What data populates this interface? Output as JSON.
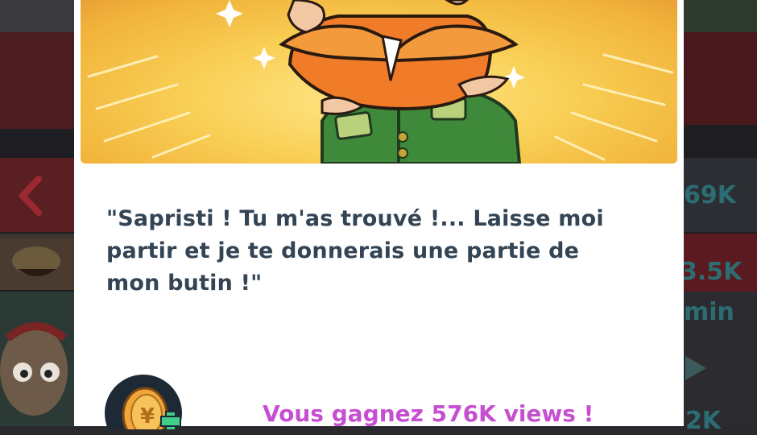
{
  "dialog": {
    "quote": "\"Sapristi ! Tu m'as trouvé !... Laisse moi partir et je te donnerais une partie de mon butin !\"",
    "reward": "Vous gagnez 576K views !",
    "reward_icon": "coin-plus-icon",
    "character_icon": "leprechaun-character"
  },
  "background": {
    "stats": [
      "69K",
      "3.5K",
      "min",
      "2K"
    ]
  },
  "colors": {
    "quote_text": "#334455",
    "reward_text": "#c64fd1",
    "art_bg": "#f9cf55"
  }
}
